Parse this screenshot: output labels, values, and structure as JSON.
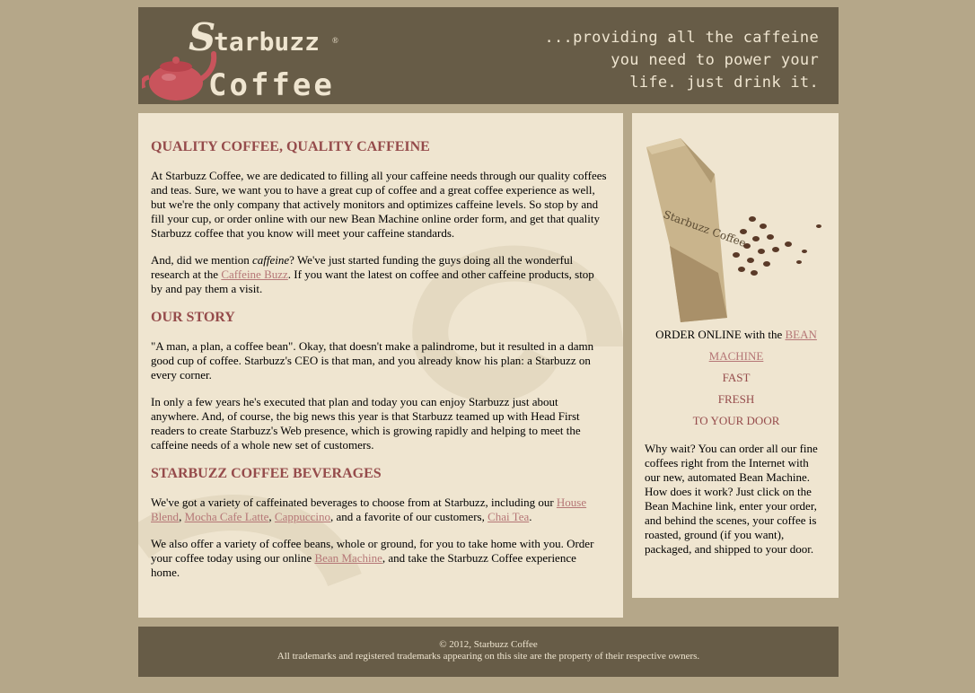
{
  "header": {
    "logo_text": "Starbuzz Coffee",
    "slogan_lines": [
      "...providing all the caffeine",
      "you need to power your",
      "life. just drink it."
    ]
  },
  "main": {
    "sections": [
      {
        "heading": "QUALITY COFFEE, QUALITY CAFFEINE",
        "p1": "At Starbuzz Coffee, we are dedicated to filling all your caffeine needs through our quality coffees and teas. Sure, we want you to have a great cup of coffee and a great coffee experience as well, but we're the only company that actively monitors and optimizes caffeine levels. So stop by and fill your cup, or order online with our new Bean Machine online order form, and get that quality Starbuzz coffee that you know will meet your caffeine standards.",
        "p2_a": "And, did we mention ",
        "p2_em": "caffeine",
        "p2_b": "? We've just started funding the guys doing all the wonderful research at the ",
        "p2_link": "Caffeine Buzz",
        "p2_c": ". If you want the latest on coffee and other caffeine products, stop by and pay them a visit."
      },
      {
        "heading": "OUR STORY",
        "p1": "\"A man, a plan, a coffee bean\". Okay, that doesn't make a palindrome, but it resulted in a damn good cup of coffee. Starbuzz's CEO is that man, and you already know his plan: a Starbuzz on every corner.",
        "p2": "In only a few years he's executed that plan and today you can enjoy Starbuzz just about anywhere. And, of course, the big news this year is that Starbuzz teamed up with Head First readers to create Starbuzz's Web presence, which is growing rapidly and helping to meet the caffeine needs of a whole new set of customers."
      },
      {
        "heading": "STARBUZZ COFFEE BEVERAGES",
        "p1_a": "We've got a variety of caffeinated beverages to choose from at Starbuzz, including our ",
        "links": [
          "House Blend",
          "Mocha Cafe Latte",
          "Cappuccino",
          "Chai Tea"
        ],
        "sep": ", ",
        "p1_b": ", and a favorite of our customers, ",
        "period": ".",
        "p2_a": "We also offer a variety of coffee beans, whole or ground, for you to take home with you. Order your coffee today using our online ",
        "p2_link": "Bean Machine",
        "p2_b": ", and take the Starbuzz Coffee experience home."
      }
    ]
  },
  "sidebar": {
    "bag_label": "Starbuzz Coffee",
    "order_prefix": "ORDER ONLINE with the ",
    "order_link": "BEAN MACHINE",
    "taglines": [
      "FAST",
      "FRESH",
      "TO YOUR DOOR"
    ],
    "why": "Why wait? You can order all our fine coffees right from the Internet with our new, automated Bean Machine. How does it work? Just click on the Bean Machine link, enter your order, and behind the scenes, your coffee is roasted, ground (if you want), packaged, and shipped to your door."
  },
  "footer": {
    "copyright": "© 2012, Starbuzz Coffee",
    "trademark": "All trademarks and registered trademarks appearing on this site are the property of their respective owners."
  },
  "colors": {
    "page_bg": "#b5a789",
    "panel_bg": "#efe5d0",
    "header_bg": "#675c47",
    "heading": "#954b4b",
    "link": "#b57676"
  }
}
